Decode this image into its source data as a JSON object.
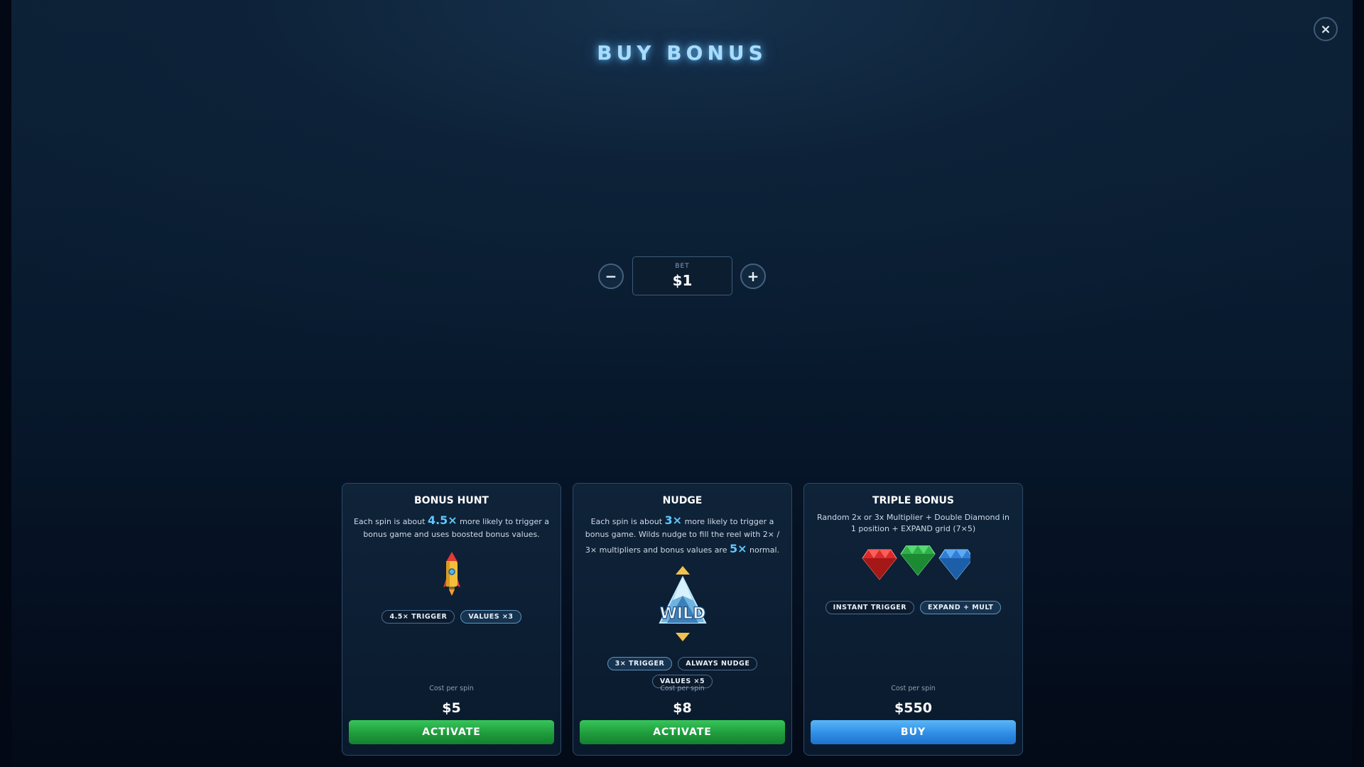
{
  "header": {
    "title": "BUY BONUS",
    "close_label": "×"
  },
  "bet": {
    "label": "BET",
    "value": "$1",
    "minus_label": "−",
    "plus_label": "+"
  },
  "cards": [
    {
      "title": "BONUS HUNT",
      "desc_before": "Each spin is about ",
      "desc_highlight": "4.5×",
      "desc_after": " more likely to trigger a bonus game and uses boosted bonus values.",
      "art_icon": "rocket-icon",
      "tags": [
        "4.5× TRIGGER",
        "VALUES ×3"
      ],
      "cost_label": "Cost per spin",
      "price": "$5",
      "button_label": "ACTIVATE",
      "button_color": "#23a844"
    },
    {
      "title": "NUDGE",
      "desc_before": "Each spin is about ",
      "desc_highlight": "3×",
      "desc_middle": " more likely to trigger a bonus game. Wilds nudge to fill the reel with 2× / 3× multipliers and bonus values are ",
      "desc_highlight2": "5×",
      "desc_after": " normal.",
      "art_icon": "wild-symbol-icon",
      "art_text": "WILD",
      "tags": [
        "3× TRIGGER",
        "ALWAYS NUDGE",
        "VALUES ×5"
      ],
      "cost_label": "Cost per spin",
      "price": "$8",
      "button_label": "ACTIVATE",
      "button_color": "#23a844"
    },
    {
      "title": "TRIPLE BONUS",
      "desc": "Random 2x or 3x Multiplier + Double Diamond in 1 position + EXPAND grid (7×5)",
      "art_icon": "diamonds-icon",
      "tags": [
        "INSTANT TRIGGER",
        "EXPAND + MULT"
      ],
      "cost_label": "Cost per spin",
      "price": "$550",
      "button_label": "BUY",
      "button_color": "#2f8ee6"
    }
  ],
  "colors": {
    "accent": "#5fc8ff",
    "green_button": "#23a844",
    "blue_button": "#2f8ee6",
    "background": "#081a2e"
  }
}
